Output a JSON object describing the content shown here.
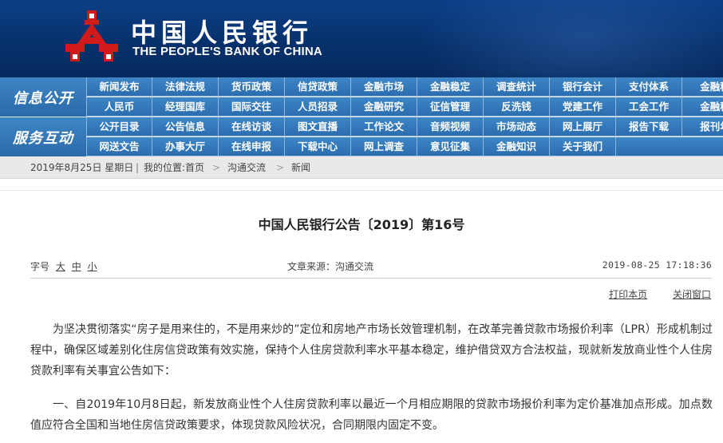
{
  "header": {
    "title_cn": "中国人民银行",
    "title_en": "THE PEOPLE'S BANK OF CHINA",
    "colors": {
      "banner": "#0a3f86",
      "emblem": "#d21a1a"
    },
    "emblem_icon": "pboc-emblem-icon"
  },
  "nav": {
    "side_labels": [
      "信息公开",
      "服务互动"
    ],
    "rows": [
      [
        "新闻发布",
        "法律法规",
        "货币政策",
        "信贷政策",
        "金融市场",
        "金融稳定",
        "调查统计",
        "银行会计",
        "支付体系",
        "金融科"
      ],
      [
        "人民币",
        "经理国库",
        "国际交往",
        "人员招录",
        "金融研究",
        "征信管理",
        "反洗钱",
        "党建工作",
        "工会工作",
        "金融科"
      ],
      [
        "公开目录",
        "公告信息",
        "在线访谈",
        "图文直播",
        "工作论文",
        "音频视频",
        "市场动态",
        "网上展厅",
        "报告下载",
        "报刊年"
      ],
      [
        "网送文告",
        "办事大厅",
        "在线申报",
        "下载中心",
        "网上调查",
        "意见征集",
        "金融知识",
        "关于我们"
      ]
    ],
    "colors": {
      "bar": "#2b6db0",
      "side": "#2a6aa9"
    }
  },
  "breadcrumb": {
    "date": "2019年8月25日  星期日",
    "location_label": "我的位置:",
    "home": "首页",
    "items": [
      "沟通交流",
      "新闻"
    ]
  },
  "article": {
    "title": "中国人民银行公告〔2019〕第16号",
    "font_size_label": "字号",
    "font_sizes": [
      "大",
      "中",
      "小"
    ],
    "source": "文章来源：沟通交流",
    "datetime": "2019-08-25 17:18:36",
    "print_label": "打印本页",
    "close_label": "关闭窗口",
    "paragraphs": [
      "为坚决贯彻落实“房子是用来住的，不是用来炒的”定位和房地产市场长效管理机制，在改革完善贷款市场报价利率（LPR）形成机制过程中，确保区域差别化住房信贷政策有效实施，保持个人住房贷款利率水平基本稳定，维护借贷双方合法权益，现就新发放商业性个人住房贷款利率有关事宜公告如下：",
      "一、自2019年10月8日起，新发放商业性个人住房贷款利率以最近一个月相应期限的贷款市场报价利率为定价基准加点形成。加点数值应符合全国和当地住房信贷政策要求，体现贷款风险状况，合同期限内固定不变。"
    ]
  }
}
